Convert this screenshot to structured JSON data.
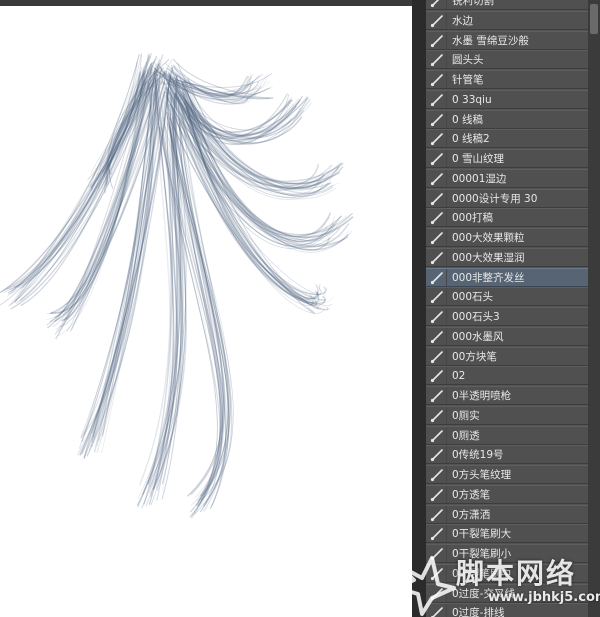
{
  "brush_panel": {
    "items": [
      {
        "label": "锐利切割"
      },
      {
        "label": "水边"
      },
      {
        "label": "水墨 雪绵豆沙般"
      },
      {
        "label": "圆头头"
      },
      {
        "label": "针管笔"
      },
      {
        "label": "0 33qiu"
      },
      {
        "label": "0 线稿"
      },
      {
        "label": "0 线稿2"
      },
      {
        "label": "0 雪山纹理"
      },
      {
        "label": "00001湿边"
      },
      {
        "label": "0000设计专用 30"
      },
      {
        "label": "000打稿"
      },
      {
        "label": "000大效果颗粒"
      },
      {
        "label": "000大效果湿润"
      },
      {
        "label": "000非整齐发丝",
        "selected": true
      },
      {
        "label": "000石头"
      },
      {
        "label": "000石头3"
      },
      {
        "label": "000水墨风"
      },
      {
        "label": "00方块笔"
      },
      {
        "label": "02"
      },
      {
        "label": "0半透明喷枪"
      },
      {
        "label": "0厕实"
      },
      {
        "label": "0厕透"
      },
      {
        "label": "0传统19号"
      },
      {
        "label": "0方头笔纹理"
      },
      {
        "label": "0方透笔"
      },
      {
        "label": "0方潇洒"
      },
      {
        "label": "0干裂笔刷大"
      },
      {
        "label": "0干裂笔刷小"
      },
      {
        "label": "0干裂笔刷中"
      },
      {
        "label": "0过度-交叉线"
      },
      {
        "label": "0过度-排线"
      }
    ],
    "brush_icon": "brush-tip-icon",
    "selected_color": "#566473"
  },
  "watermark": {
    "title": "脚本网络",
    "url": "www.jbhkj5.com"
  },
  "canvas": {
    "stroke_color": "#4a5f7d"
  }
}
